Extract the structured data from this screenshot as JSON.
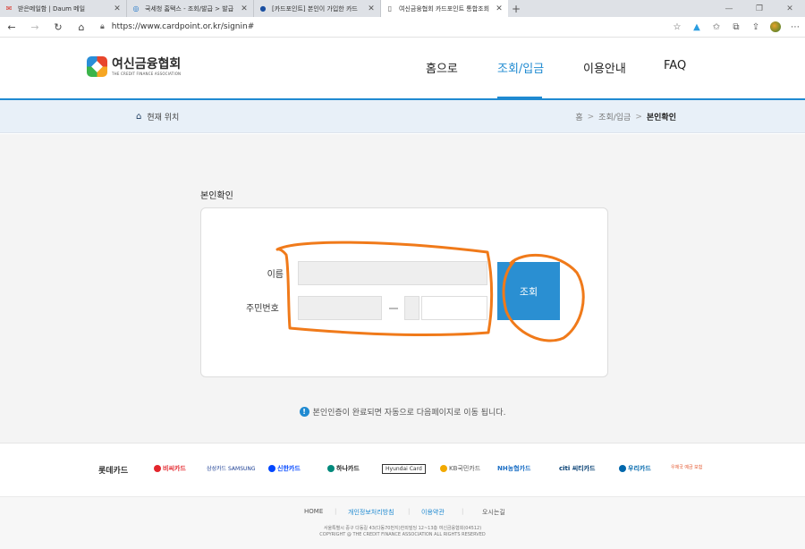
{
  "browser": {
    "tabs": [
      {
        "title": "받은메일함 | Daum 메일",
        "icon": "mail-icon",
        "active": false
      },
      {
        "title": "국세청 홈택스 - 조회/발급 > 발급",
        "icon": "hometax-icon",
        "active": false
      },
      {
        "title": "[카드포인트] 본인이 가입한 카드",
        "icon": "globe-icon",
        "active": false
      },
      {
        "title": "여신금융협회 카드포인트 통합조회",
        "icon": "page-icon",
        "active": true
      }
    ],
    "url": "https://www.cardpoint.or.kr/signin#"
  },
  "site": {
    "logo_main": "여신금융협회",
    "logo_sub": "THE CREDIT FINANCE ASSOCIATION",
    "nav": [
      {
        "label": "홈으로",
        "active": false
      },
      {
        "label": "조회/입금",
        "active": true
      },
      {
        "label": "이용안내",
        "active": false
      },
      {
        "label": "FAQ",
        "active": false
      }
    ],
    "accent": "#1f8ad1"
  },
  "location": {
    "label": "현재 위치",
    "crumbs": [
      "홈",
      "조회/입금",
      "본인확인"
    ]
  },
  "form": {
    "title": "본인확인",
    "name_label": "이름",
    "rrn_label": "주민번호",
    "submit_label": "조회",
    "notice": "본인인증이 완료되면 자동으로 다음페이지로 이동 됩니다."
  },
  "partners": [
    {
      "name": "롯데카드",
      "color": "#222"
    },
    {
      "name": "비씨카드",
      "color": "#e3262c"
    },
    {
      "name": "삼성카드 SAMSUNG",
      "color": "#1c3f94"
    },
    {
      "name": "신한카드",
      "color": "#0046ff"
    },
    {
      "name": "하나카드",
      "color": "#00897b"
    },
    {
      "name": "Hyundai Card",
      "color": "#222"
    },
    {
      "name": "KB국민카드",
      "color": "#f2a900"
    },
    {
      "name": "NH농협카드",
      "color": "#1c6fc5"
    },
    {
      "name": "citi 씨티카드",
      "color": "#003b70"
    },
    {
      "name": "우리카드",
      "color": "#0067ac"
    },
    {
      "name": "우체국 예금 보험",
      "color": "#e4572e"
    }
  ],
  "footer": {
    "links": [
      "HOME",
      "개인정보처리방침",
      "이용약관",
      "오시는길"
    ],
    "address": "서울특별시 중구 다동길 43(다동70번지)한외빌딩 12~13층 여신금융협회(04512)",
    "copyright": "COPYRIGHT @ THE CREDIT FINANCE ASSOCIATION ALL RIGHTS RESERVED"
  }
}
